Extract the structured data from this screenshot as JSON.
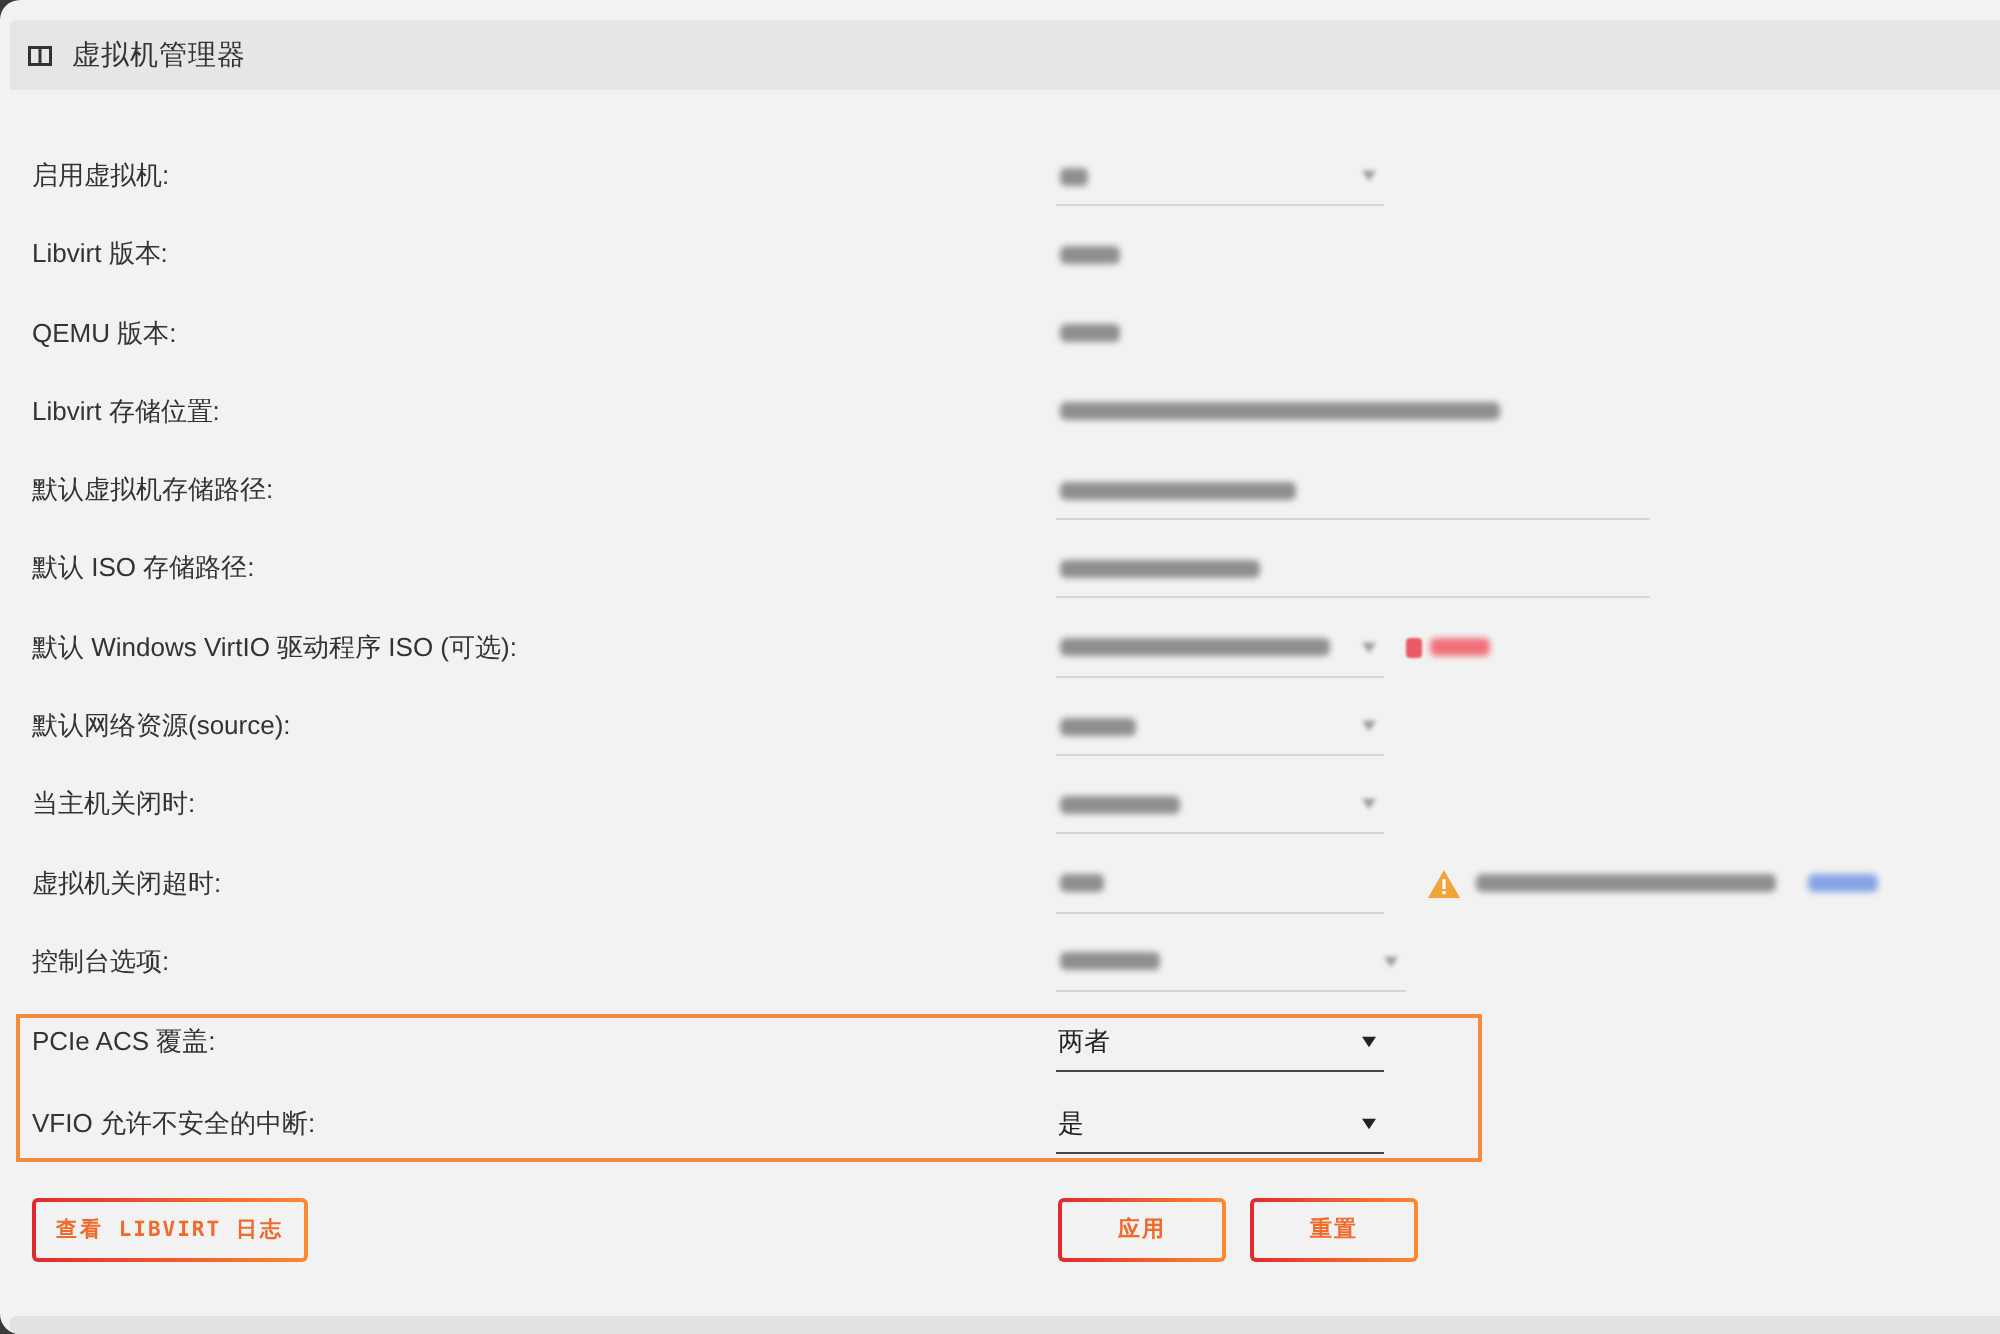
{
  "panel": {
    "title": "虚拟机管理器"
  },
  "settings": [
    {
      "label": "启用虚拟机:",
      "kind": "select",
      "blurred": true,
      "highlighted": false
    },
    {
      "label": "Libvirt 版本:",
      "kind": "static",
      "blurred": true,
      "highlighted": false
    },
    {
      "label": "QEMU 版本:",
      "kind": "static",
      "blurred": true,
      "highlighted": false
    },
    {
      "label": "Libvirt 存储位置:",
      "kind": "static",
      "blurred": true,
      "highlighted": false
    },
    {
      "label": "默认虚拟机存储路径:",
      "kind": "input",
      "blurred": true,
      "highlighted": false
    },
    {
      "label": "默认 ISO 存储路径:",
      "kind": "input",
      "blurred": true,
      "highlighted": false
    },
    {
      "label": "默认 Windows VirtIO 驱动程序 ISO (可选):",
      "kind": "select",
      "blurred": true,
      "highlighted": false,
      "note": {
        "kind": "error"
      }
    },
    {
      "label": "默认网络资源(source):",
      "kind": "select",
      "blurred": true,
      "highlighted": false
    },
    {
      "label": "当主机关闭时:",
      "kind": "select",
      "blurred": true,
      "highlighted": false
    },
    {
      "label": "虚拟机关闭超时:",
      "kind": "input",
      "blurred": true,
      "highlighted": false,
      "note": {
        "kind": "warning"
      }
    },
    {
      "label": "控制台选项:",
      "kind": "select",
      "blurred": true,
      "highlighted": false
    },
    {
      "label": "PCIe ACS 覆盖:",
      "kind": "select",
      "blurred": false,
      "value": "两者",
      "highlighted": true
    },
    {
      "label": "VFIO 允许不安全的中断:",
      "kind": "select",
      "blurred": false,
      "value": "是",
      "highlighted": true
    }
  ],
  "log_button": {
    "label": "查看 LIBVIRT 日志"
  },
  "actions": [
    "应用",
    "重置"
  ]
}
